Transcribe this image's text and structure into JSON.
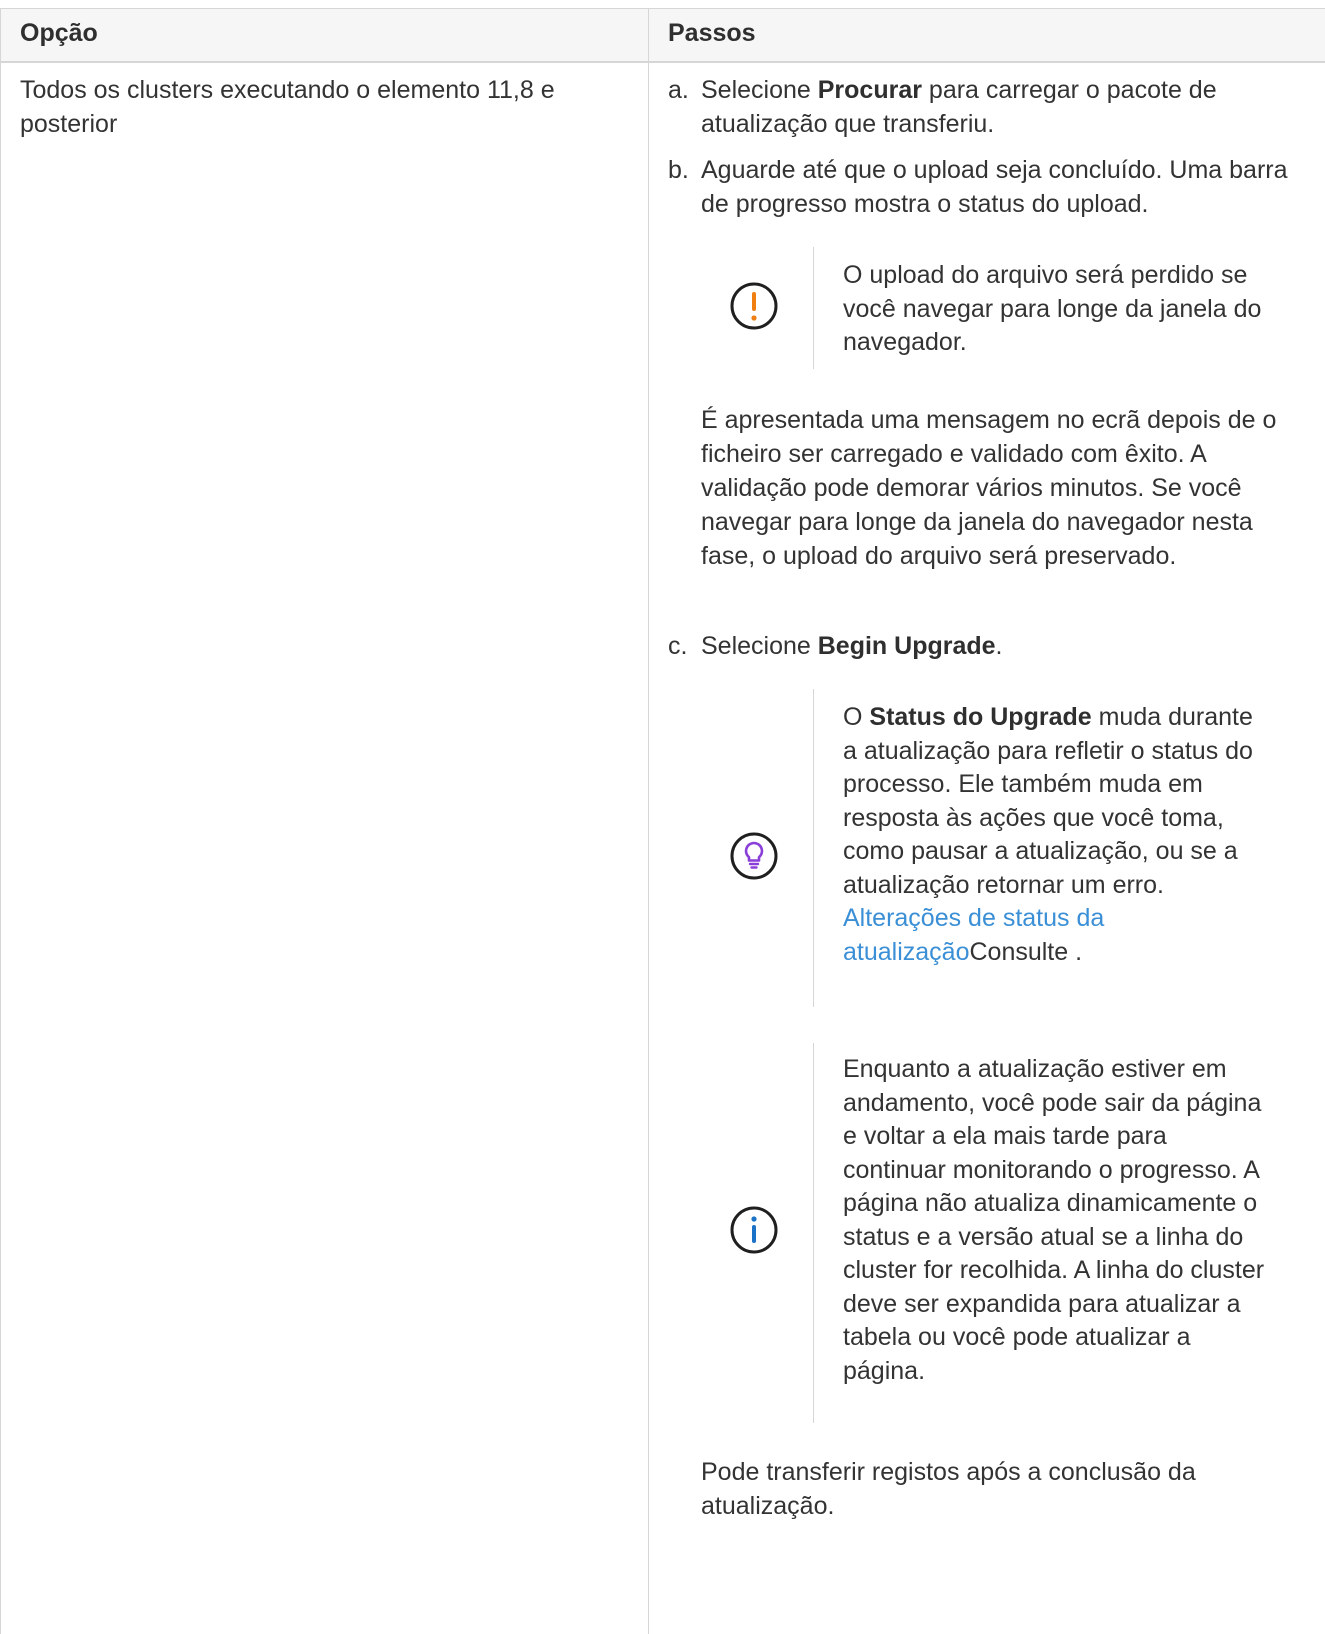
{
  "table": {
    "headers": [
      "Opção",
      "Passos"
    ],
    "option_cell": "Todos os clusters executando o elemento 11,8 e posterior"
  },
  "steps": {
    "a": {
      "letter": "a.",
      "pre": "Selecione ",
      "bold": "Procurar",
      "post": " para carregar o pacote de atualização que transferiu."
    },
    "b": {
      "letter": "b.",
      "text": "Aguarde até que o upload seja concluído. Uma barra de progresso mostra o status do upload.",
      "note_warning": "O upload do arquivo será perdido se você navegar para longe da janela do navegador.",
      "after_text": "É apresentada uma mensagem no ecrã depois de o ficheiro ser carregado e validado com êxito. A validação pode demorar vários minutos. Se você navegar para longe da janela do navegador nesta fase, o upload do arquivo será preservado."
    },
    "c": {
      "letter": "c.",
      "pre": "Selecione ",
      "bold": "Begin Upgrade",
      "post": ".",
      "tip_pre": "O ",
      "tip_bold": "Status do Upgrade",
      "tip_post": " muda durante a atualização para refletir o status do processo. Ele também muda em resposta às ações que você toma, como pausar a atualização, ou se a atualização retornar um erro.",
      "tip_link": "Alterações de status da atualização",
      "tip_tail": "Consulte .",
      "info_text": "Enquanto a atualização estiver em andamento, você pode sair da página e voltar a ela mais tarde para continuar monitorando o progresso. A página não atualiza dinamicamente o status e a versão atual se a linha do cluster for recolhida. A linha do cluster deve ser expandida para atualizar a tabela ou você pode atualizar a página.",
      "final_text": "Pode transferir registos após a conclusão da atualização."
    }
  },
  "icons": {
    "warning": "warning-icon",
    "tip": "lightbulb-icon",
    "info": "info-icon"
  },
  "colors": {
    "warning": "#f07f12",
    "tip": "#8b3fd9",
    "info": "#1a73c7",
    "link": "#3a8fd6"
  }
}
